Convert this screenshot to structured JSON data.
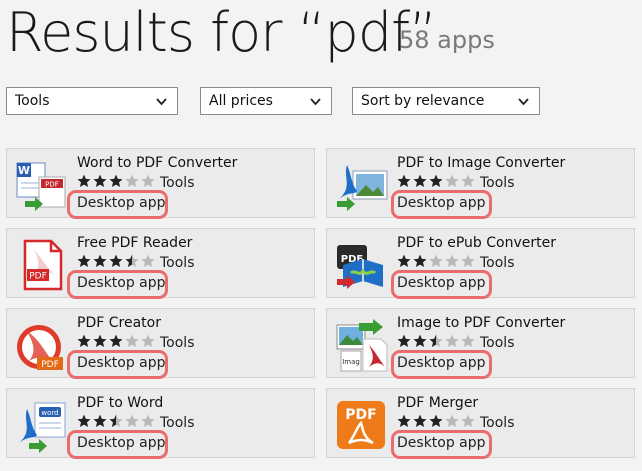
{
  "header": {
    "title": "Results for “pdf”",
    "count": "58 apps"
  },
  "filters": [
    {
      "value": "Tools"
    },
    {
      "value": "All prices"
    },
    {
      "value": "Sort by relevance"
    }
  ],
  "apps": [
    {
      "name": "Word to PDF Converter",
      "rating": 3,
      "category": "Tools",
      "kind": "Desktop app",
      "icon": "word-to-pdf-icon"
    },
    {
      "name": "PDF to Image Converter",
      "rating": 3,
      "category": "Tools",
      "kind": "Desktop app",
      "icon": "pdf-to-image-icon"
    },
    {
      "name": "Free PDF Reader",
      "rating": 3.5,
      "category": "Tools",
      "kind": "Desktop app",
      "icon": "pdf-reader-icon"
    },
    {
      "name": "PDF to ePub Converter",
      "rating": 2,
      "category": "Tools",
      "kind": "Desktop app",
      "icon": "pdf-to-epub-icon"
    },
    {
      "name": "PDF Creator",
      "rating": 3,
      "category": "Tools",
      "kind": "Desktop app",
      "icon": "pdf-creator-icon"
    },
    {
      "name": "Image to PDF Converter",
      "rating": 2.5,
      "category": "Tools",
      "kind": "Desktop app",
      "icon": "image-to-pdf-icon"
    },
    {
      "name": "PDF to Word",
      "rating": 2.5,
      "category": "Tools",
      "kind": "Desktop app",
      "icon": "pdf-to-word-icon"
    },
    {
      "name": "PDF Merger",
      "rating": 3,
      "category": "Tools",
      "kind": "Desktop app",
      "icon": "pdf-merger-icon"
    }
  ],
  "colors": {
    "highlight": "#ea6c6c",
    "star_filled": "#222222",
    "star_empty": "#b8b8b8",
    "background": "#f3f3f3"
  }
}
